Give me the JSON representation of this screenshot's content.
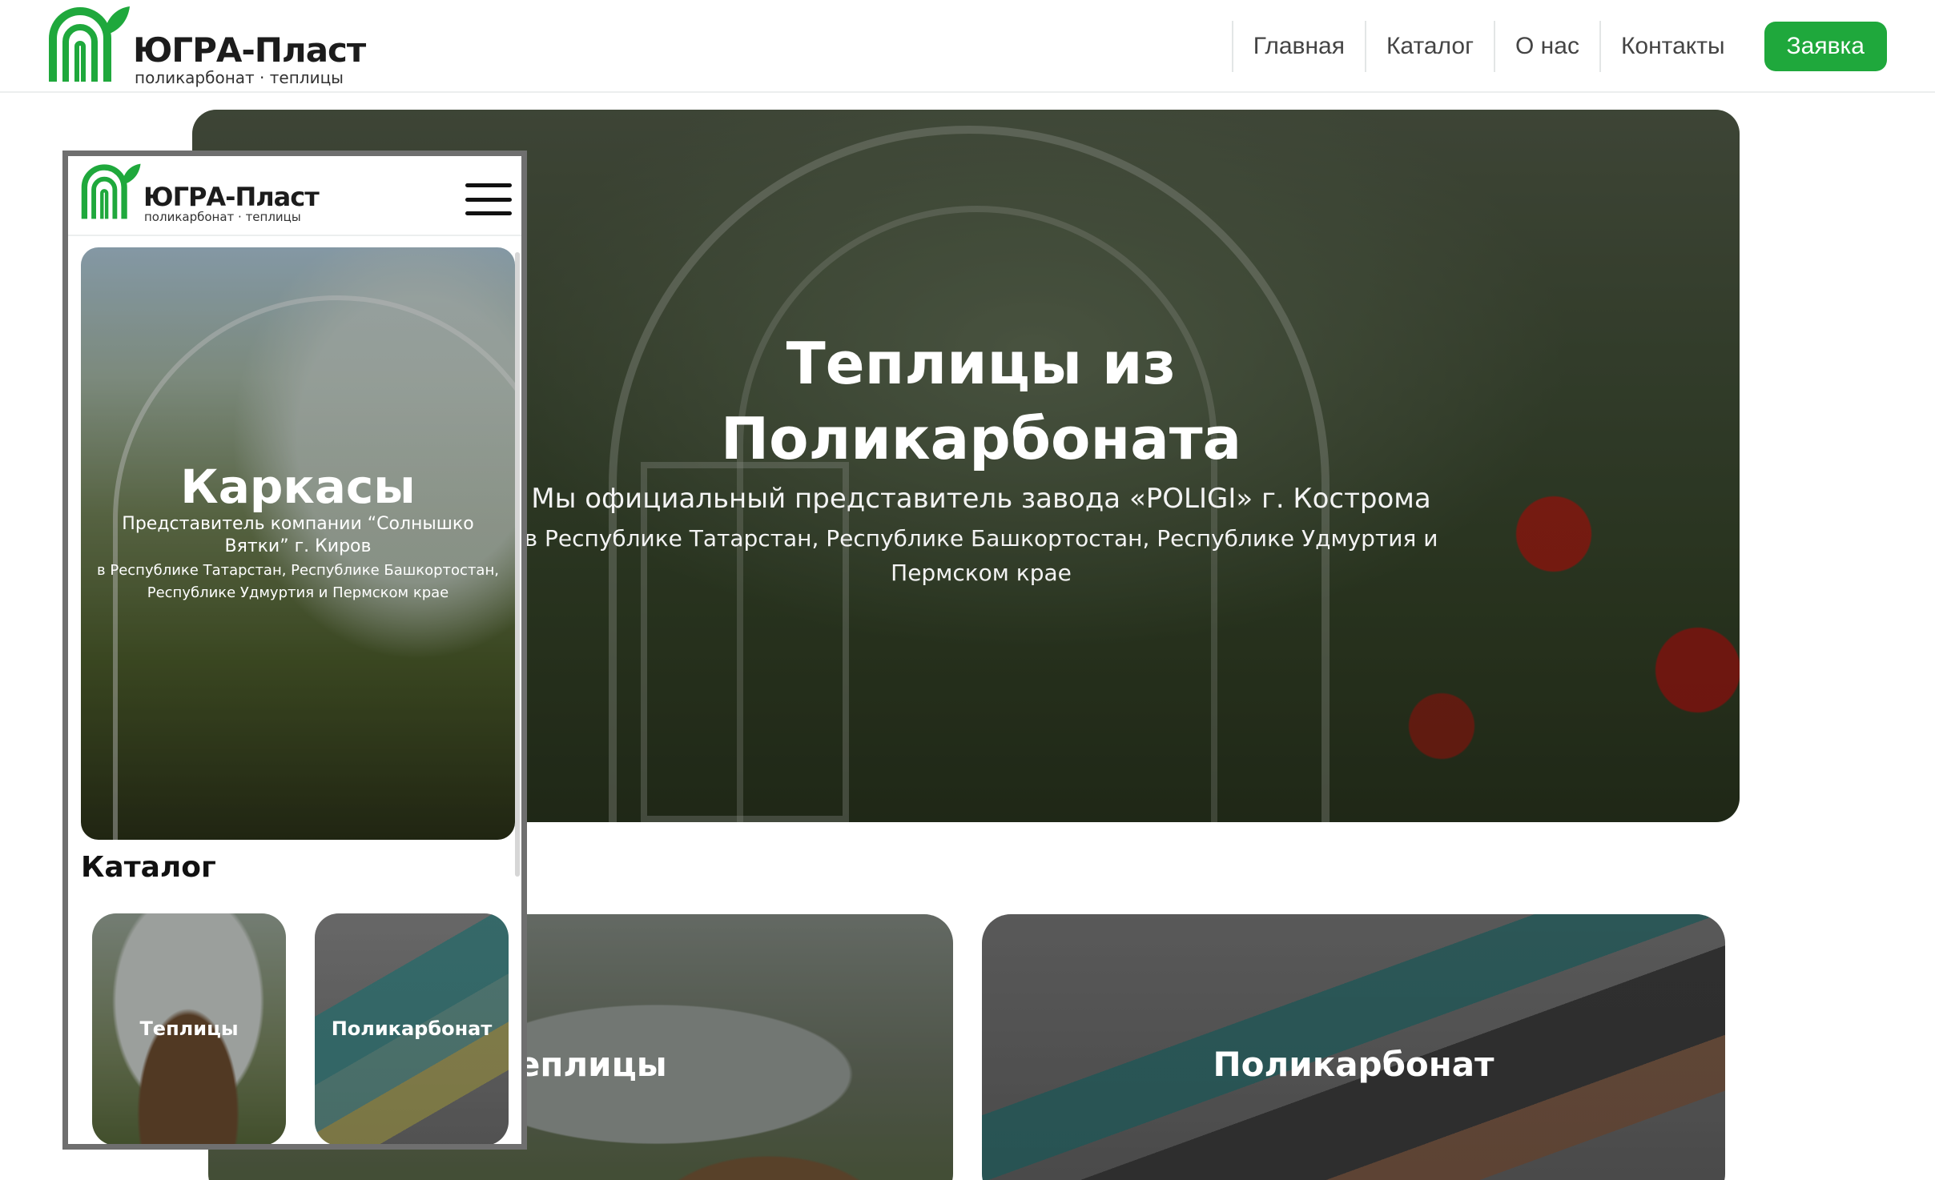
{
  "brand": {
    "name": "ЮГРА-Пласт",
    "tagline": "поликарбонат · теплицы",
    "accent": "#1fa83c"
  },
  "desktop": {
    "nav": {
      "items": [
        "Главная",
        "Каталог",
        "О нас",
        "Контакты"
      ],
      "cta": "Заявка"
    },
    "hero": {
      "title_line1": "Теплицы из",
      "title_line2": "Поликарбоната",
      "subtitle": "Мы официальный представитель завода «POLIGI» г. Кострома",
      "regions": "в Республике Татарстан, Республике Башкортостан, Республике Удмуртия и Пермском крае"
    },
    "catalog_cards": [
      "Теплицы",
      "Поликарбонат"
    ]
  },
  "mobile": {
    "menu_icon": "hamburger-icon",
    "hero": {
      "title": "Каркасы",
      "subtitle": "Представитель компании “Солнышко Вятки” г. Киров",
      "regions": "в Республике Татарстан, Республике Башкортостан, Республике Удмуртия и Пермском крае"
    },
    "catalog_title": "Каталог",
    "catalog_cards": [
      "Теплицы",
      "Поликарбонат"
    ]
  },
  "icons": {
    "logo": "greenhouse-arch-leaf-logo",
    "menu": "hamburger-icon"
  }
}
